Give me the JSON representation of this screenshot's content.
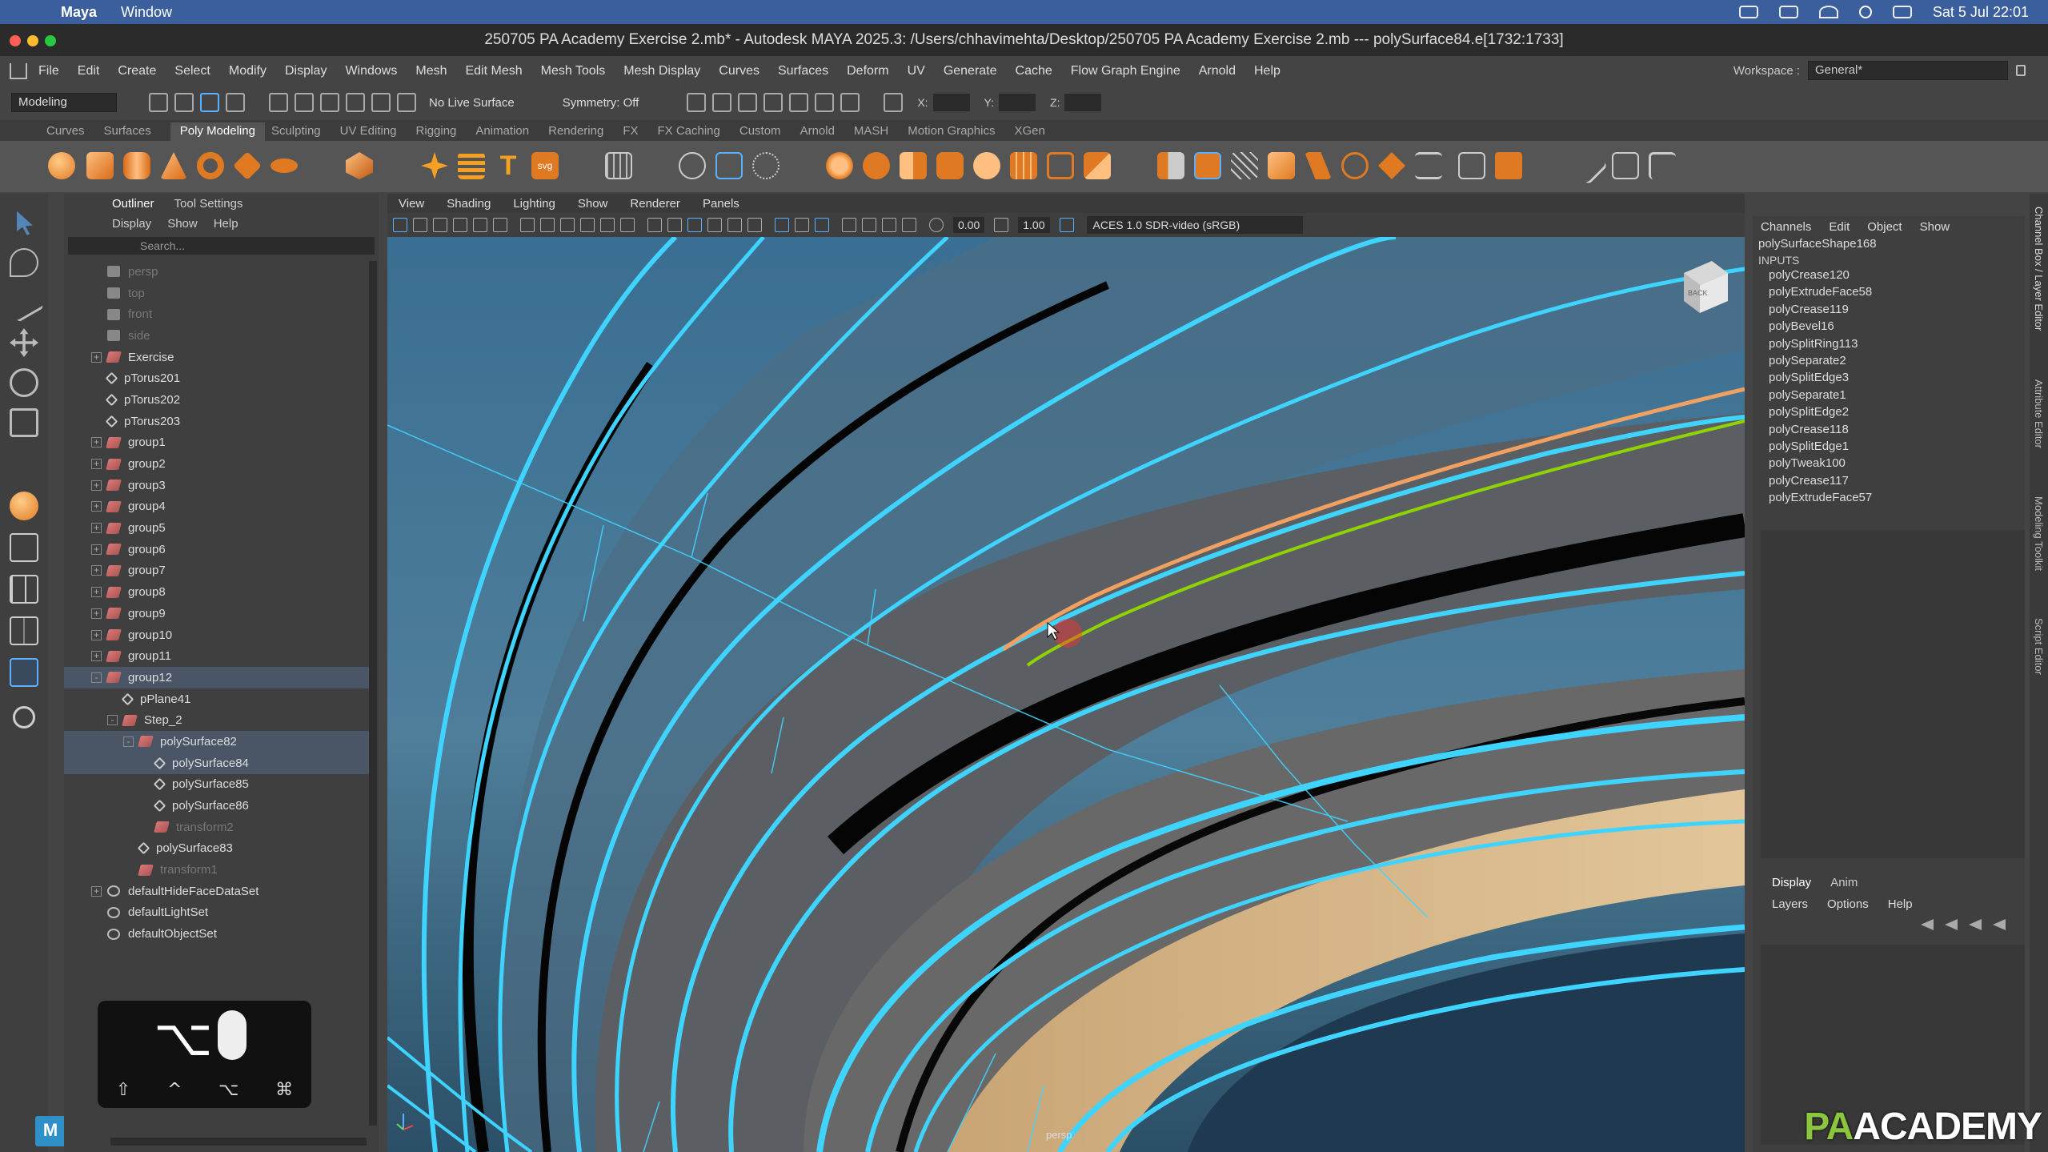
{
  "mac_menubar": {
    "app": "Maya",
    "items": [
      "Window"
    ],
    "clock": "Sat 5 Jul  22:01"
  },
  "window": {
    "title": "250705 PA Academy Exercise 2.mb* - Autodesk MAYA 2025.3: /Users/chhavimehta/Desktop/250705 PA Academy Exercise 2.mb  ---  polySurface84.e[1732:1733]"
  },
  "main_menu": {
    "items": [
      "File",
      "Edit",
      "Create",
      "Select",
      "Modify",
      "Display",
      "Windows",
      "Mesh",
      "Edit Mesh",
      "Mesh Tools",
      "Mesh Display",
      "Curves",
      "Surfaces",
      "Deform",
      "UV",
      "Generate",
      "Cache",
      "Flow Graph Engine",
      "Arnold",
      "Help"
    ],
    "workspace_label": "Workspace :",
    "workspace_value": "General*"
  },
  "status_line": {
    "mode": "Modeling",
    "live_surface": "No Live Surface",
    "symmetry": "Symmetry: Off",
    "x_label": "X:",
    "y_label": "Y:",
    "z_label": "Z:"
  },
  "shelf": {
    "tabs": [
      "Curves",
      "Surfaces",
      "Poly Modeling",
      "Sculpting",
      "UV Editing",
      "Rigging",
      "Animation",
      "Rendering",
      "FX",
      "FX Caching",
      "Custom",
      "Arnold",
      "MASH",
      "Motion Graphics",
      "XGen"
    ],
    "active_tab": "Poly Modeling"
  },
  "outliner": {
    "tabs": [
      "Outliner",
      "Tool Settings"
    ],
    "menu": [
      "Display",
      "Show",
      "Help"
    ],
    "search_placeholder": "Search...",
    "rows": [
      {
        "label": "persp",
        "depth": 1,
        "icon": "camera-icon",
        "dim": true
      },
      {
        "label": "top",
        "depth": 1,
        "icon": "camera-icon",
        "dim": true
      },
      {
        "label": "front",
        "depth": 1,
        "icon": "camera-icon",
        "dim": true
      },
      {
        "label": "side",
        "depth": 1,
        "icon": "camera-icon",
        "dim": true
      },
      {
        "label": "Exercise",
        "depth": 1,
        "icon": "group-icon",
        "expander": "+"
      },
      {
        "label": "pTorus201",
        "depth": 1,
        "icon": "mesh-icon"
      },
      {
        "label": "pTorus202",
        "depth": 1,
        "icon": "mesh-icon"
      },
      {
        "label": "pTorus203",
        "depth": 1,
        "icon": "mesh-icon"
      },
      {
        "label": "group1",
        "depth": 1,
        "icon": "group-icon",
        "expander": "+"
      },
      {
        "label": "group2",
        "depth": 1,
        "icon": "group-icon",
        "expander": "+"
      },
      {
        "label": "group3",
        "depth": 1,
        "icon": "group-icon",
        "expander": "+"
      },
      {
        "label": "group4",
        "depth": 1,
        "icon": "group-icon",
        "expander": "+"
      },
      {
        "label": "group5",
        "depth": 1,
        "icon": "group-icon",
        "expander": "+"
      },
      {
        "label": "group6",
        "depth": 1,
        "icon": "group-icon",
        "expander": "+"
      },
      {
        "label": "group7",
        "depth": 1,
        "icon": "group-icon",
        "expander": "+"
      },
      {
        "label": "group8",
        "depth": 1,
        "icon": "group-icon",
        "expander": "+"
      },
      {
        "label": "group9",
        "depth": 1,
        "icon": "group-icon",
        "expander": "+"
      },
      {
        "label": "group10",
        "depth": 1,
        "icon": "group-icon",
        "expander": "+"
      },
      {
        "label": "group11",
        "depth": 1,
        "icon": "group-icon",
        "expander": "+"
      },
      {
        "label": "group12",
        "depth": 1,
        "icon": "group-icon",
        "expander": "-",
        "selected": true
      },
      {
        "label": "pPlane41",
        "depth": 2,
        "icon": "mesh-icon"
      },
      {
        "label": "Step_2",
        "depth": 2,
        "icon": "group-icon",
        "expander": "-"
      },
      {
        "label": "polySurface82",
        "depth": 3,
        "icon": "group-icon",
        "expander": "-",
        "selected": true
      },
      {
        "label": "polySurface84",
        "depth": 4,
        "icon": "mesh-icon",
        "selected": true
      },
      {
        "label": "polySurface85",
        "depth": 4,
        "icon": "mesh-icon"
      },
      {
        "label": "polySurface86",
        "depth": 4,
        "icon": "mesh-icon"
      },
      {
        "label": "transform2",
        "depth": 4,
        "icon": "group-icon",
        "dim": true
      },
      {
        "label": "polySurface83",
        "depth": 3,
        "icon": "mesh-icon"
      },
      {
        "label": "transform1",
        "depth": 3,
        "icon": "group-icon",
        "dim": true
      },
      {
        "label": "defaultHideFaceDataSet",
        "depth": 1,
        "icon": "set-icon",
        "expander": "+"
      },
      {
        "label": "defaultLightSet",
        "depth": 1,
        "icon": "set-icon"
      },
      {
        "label": "defaultObjectSet",
        "depth": 1,
        "icon": "set-icon"
      }
    ]
  },
  "key_overlay": {
    "main_key": "⌥",
    "modifiers": [
      "⇧",
      "^",
      "⌥",
      "⌘"
    ]
  },
  "viewport": {
    "menu": [
      "View",
      "Shading",
      "Lighting",
      "Show",
      "Renderer",
      "Panels"
    ],
    "exposure": "0.00",
    "gamma": "1.00",
    "color_space": "ACES 1.0 SDR-video (sRGB)",
    "camera_label": "persp",
    "view_cube": "BACK"
  },
  "channel_box": {
    "menu": [
      "Channels",
      "Edit",
      "Object",
      "Show"
    ],
    "shape": "polySurfaceShape168",
    "inputs_label": "INPUTS",
    "inputs": [
      "polyCrease120",
      "polyExtrudeFace58",
      "polyCrease119",
      "polyBevel16",
      "polySplitRing113",
      "polySeparate2",
      "polySplitEdge3",
      "polySeparate1",
      "polySplitEdge2",
      "polyCrease118",
      "polySplitEdge1",
      "polyTweak100",
      "polyCrease117",
      "polyExtrudeFace57"
    ],
    "layer_tabs": [
      "Display",
      "Anim"
    ],
    "layer_menu": [
      "Layers",
      "Options",
      "Help"
    ]
  },
  "right_strip": {
    "tabs": [
      "Channel Box / Layer Editor",
      "Attribute Editor",
      "Modeling Toolkit",
      "Script Editor"
    ]
  },
  "watermark": {
    "pa": "PA",
    "rest": "ACADEMY"
  },
  "colors": {
    "wire": "#3fd4ff",
    "selection_orange": "#f0a060",
    "selection_green": "#8fd400",
    "face_highlight": "#d9b582"
  }
}
